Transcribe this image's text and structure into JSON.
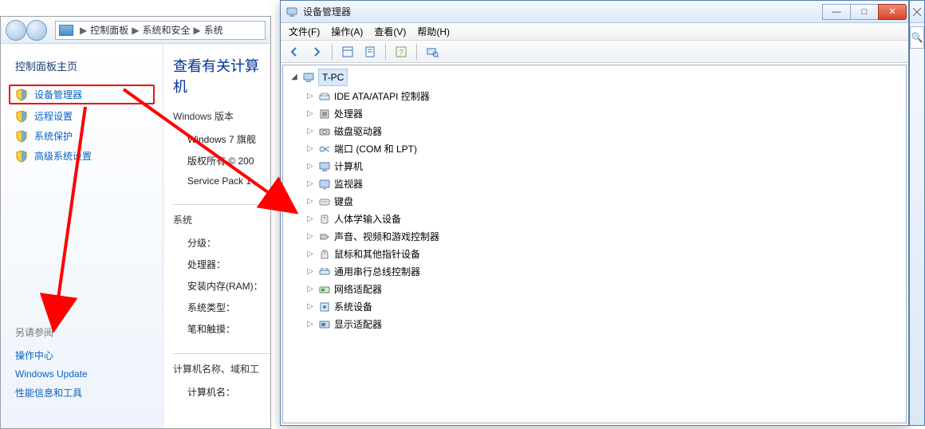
{
  "control_panel": {
    "breadcrumb": {
      "items": [
        "控制面板",
        "系统和安全",
        "系统"
      ]
    },
    "home_link": "控制面板主页",
    "side_links": [
      {
        "label": "设备管理器",
        "highlight": true
      },
      {
        "label": "远程设置"
      },
      {
        "label": "系统保护"
      },
      {
        "label": "高级系统设置"
      }
    ],
    "see_also": {
      "heading": "另请参阅",
      "links": [
        "操作中心",
        "Windows Update",
        "性能信息和工具"
      ]
    },
    "main": {
      "heading": "查看有关计算机",
      "section1_title": "Windows 版本",
      "windows_edition": "Windows 7 旗舰",
      "copyright": "版权所有 © 200",
      "service_pack": "Service Pack 1",
      "section2_title": "系统",
      "rows": [
        {
          "label": "分级："
        },
        {
          "label": "处理器："
        },
        {
          "label": "安装内存(RAM)："
        },
        {
          "label": "系统类型："
        },
        {
          "label": "笔和触摸："
        }
      ],
      "section3_title": "计算机名称、域和工",
      "computer_name_label": "计算机名："
    }
  },
  "device_manager": {
    "title": "设备管理器",
    "menu": {
      "file": "文件(F)",
      "action": "操作(A)",
      "view": "查看(V)",
      "help": "帮助(H)"
    },
    "win_buttons": {
      "min": "—",
      "max": "□",
      "close": "✕"
    },
    "root": "T-PC",
    "devices": [
      "IDE ATA/ATAPI 控制器",
      "处理器",
      "磁盘驱动器",
      "端口 (COM 和 LPT)",
      "计算机",
      "监视器",
      "键盘",
      "人体学输入设备",
      "声音、视频和游戏控制器",
      "鼠标和其他指针设备",
      "通用串行总线控制器",
      "网络适配器",
      "系统设备",
      "显示适配器"
    ]
  },
  "right_sliver": {
    "search_glyph": "🔍"
  }
}
